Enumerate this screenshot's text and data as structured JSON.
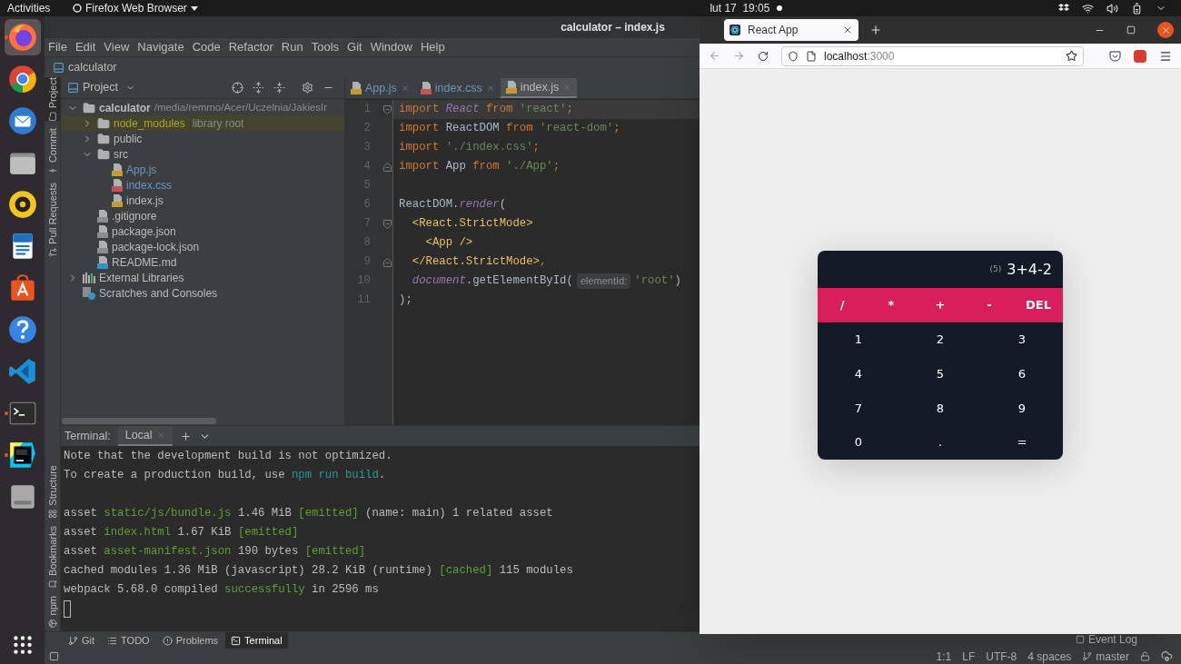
{
  "top_bar": {
    "activities": "Activities",
    "app_menu": "Firefox Web Browser",
    "clock": "lut 17  19:05"
  },
  "dock": [
    {
      "kind": "firefox",
      "running": true,
      "selected": true
    },
    {
      "kind": "chrome",
      "running": false,
      "selected": false
    },
    {
      "kind": "mail",
      "running": false,
      "selected": false
    },
    {
      "kind": "files",
      "running": false,
      "selected": false
    },
    {
      "kind": "music",
      "running": false,
      "selected": false
    },
    {
      "kind": "writer",
      "running": false,
      "selected": false
    },
    {
      "kind": "store",
      "running": false,
      "selected": false
    },
    {
      "kind": "help",
      "running": false,
      "selected": false
    },
    {
      "kind": "vscode",
      "running": false,
      "selected": false
    },
    {
      "kind": "terminal",
      "running": true,
      "selected": false
    },
    {
      "kind": "webstorm",
      "running": true,
      "selected": false
    },
    {
      "kind": "drive",
      "running": false,
      "selected": false
    }
  ],
  "ide": {
    "title": "calculator – index.js",
    "menu": [
      "File",
      "Edit",
      "View",
      "Navigate",
      "Code",
      "Refactor",
      "Run",
      "Tools",
      "Git",
      "Window",
      "Help"
    ],
    "breadcrumb": "calculator",
    "left_tabs": [
      {
        "label": "Project",
        "kind": "project",
        "selected": true
      },
      {
        "label": "Commit",
        "kind": "commit",
        "selected": false
      },
      {
        "label": "Pull Requests",
        "kind": "pull",
        "selected": false
      }
    ],
    "left_tabs_bottom": [
      {
        "label": "Structure",
        "kind": "structure",
        "selected": false
      },
      {
        "label": "Bookmarks",
        "kind": "bookmarks",
        "selected": false
      },
      {
        "label": "npm",
        "kind": "npm",
        "selected": false
      }
    ],
    "project": {
      "title": "Project",
      "tree": [
        {
          "kind": "root",
          "label": "calculator",
          "path": "/media/remmo/Acer/Uczelnia/JakiesIr",
          "expanded": true,
          "children": [
            {
              "kind": "excluded",
              "label": "node_modules",
              "note": "library root",
              "expanded": false
            },
            {
              "kind": "folder",
              "label": "public",
              "expanded": false
            },
            {
              "kind": "folder",
              "label": "src",
              "expanded": true,
              "children": [
                {
                  "kind": "js",
                  "label": "App.js",
                  "modified": true
                },
                {
                  "kind": "css",
                  "label": "index.css",
                  "modified": true
                },
                {
                  "kind": "js",
                  "label": "index.js",
                  "modified": false
                }
              ]
            },
            {
              "kind": "config",
              "label": ".gitignore",
              "modified": false
            },
            {
              "kind": "config",
              "label": "package.json",
              "modified": false
            },
            {
              "kind": "config",
              "label": "package-lock.json",
              "modified": false
            },
            {
              "kind": "md",
              "label": "README.md",
              "modified": false
            }
          ]
        },
        {
          "kind": "libraries",
          "label": "External Libraries",
          "expanded": false
        },
        {
          "kind": "scratches",
          "label": "Scratches and Consoles"
        }
      ]
    },
    "editor": {
      "tabs": [
        {
          "label": "App.js",
          "kind": "js",
          "modified": true,
          "selected": false
        },
        {
          "label": "index.css",
          "kind": "css",
          "modified": true,
          "selected": false
        },
        {
          "label": "index.js",
          "kind": "js",
          "modified": false,
          "selected": true
        }
      ],
      "lines": [
        {
          "number": "1",
          "current": true,
          "kind": "fold_start",
          "tokens": [
            {
              "text": "import ",
              "kind": "kw"
            },
            {
              "text": "React",
              "kind": "member"
            },
            {
              "text": " from ",
              "kind": "kw"
            },
            {
              "text": "'react'",
              "kind": "str"
            },
            {
              "text": ";",
              "kind": "kw"
            }
          ]
        },
        {
          "number": "2",
          "current": false,
          "kind": "plain",
          "tokens": [
            {
              "text": "import ",
              "kind": "kw"
            },
            {
              "text": "ReactDOM",
              "kind": "id"
            },
            {
              "text": " from ",
              "kind": "kw"
            },
            {
              "text": "'react-dom'",
              "kind": "str"
            },
            {
              "text": ";",
              "kind": "kw"
            }
          ]
        },
        {
          "number": "3",
          "current": false,
          "kind": "plain",
          "tokens": [
            {
              "text": "import ",
              "kind": "kw"
            },
            {
              "text": "'./index.css'",
              "kind": "str"
            },
            {
              "text": ";",
              "kind": "kw"
            }
          ]
        },
        {
          "number": "4",
          "current": false,
          "kind": "fold_end",
          "tokens": [
            {
              "text": "import ",
              "kind": "kw"
            },
            {
              "text": "App",
              "kind": "id"
            },
            {
              "text": " from ",
              "kind": "kw"
            },
            {
              "text": "'./App'",
              "kind": "str"
            },
            {
              "text": ";",
              "kind": "kw"
            }
          ]
        },
        {
          "number": "5",
          "current": false,
          "kind": "plain"
        },
        {
          "number": "6",
          "current": false,
          "kind": "plain",
          "tokens": [
            {
              "text": "ReactDOM.",
              "kind": "id"
            },
            {
              "text": "render",
              "kind": "member"
            },
            {
              "text": "(",
              "kind": "id"
            }
          ]
        },
        {
          "number": "7",
          "current": false,
          "kind": "fold_start",
          "tokens": [
            {
              "text": "  <React.StrictMode>",
              "kind": "tag"
            }
          ]
        },
        {
          "number": "8",
          "current": false,
          "kind": "plain",
          "tokens": [
            {
              "text": "    <App />",
              "kind": "tag"
            }
          ]
        },
        {
          "number": "9",
          "current": false,
          "kind": "fold_end",
          "tokens": [
            {
              "text": "  </React.StrictMode>",
              "kind": "tag"
            },
            {
              "text": ",",
              "kind": "kw"
            }
          ]
        },
        {
          "number": "10",
          "current": false,
          "kind": "plain",
          "tokens": [
            {
              "text": "  document",
              "kind": "member"
            },
            {
              "text": ".getElementById(",
              "kind": "id"
            },
            {
              "text": "elementId:",
              "kind": "hint"
            },
            {
              "text": "'root'",
              "kind": "str"
            },
            {
              "text": ")",
              "kind": "id"
            }
          ]
        },
        {
          "number": "11",
          "current": false,
          "kind": "plain",
          "tokens": [
            {
              "text": ");",
              "kind": "id"
            }
          ]
        }
      ]
    },
    "terminal": {
      "title": "Terminal:",
      "tabs": [
        {
          "label": "Local",
          "selected": true
        }
      ],
      "blocks": [
        [
          [
            {
              "text": "Note that the development build is not optimized.",
              "kind": "plain"
            }
          ],
          [
            {
              "text": "To create a production build, use ",
              "kind": "plain"
            },
            {
              "text": "npm run build",
              "kind": "command"
            },
            {
              "text": ".",
              "kind": "plain"
            }
          ]
        ],
        [
          [
            {
              "text": "asset ",
              "kind": "plain"
            },
            {
              "text": "static/js/bundle.js",
              "kind": "ok"
            },
            {
              "text": " 1.46 MiB ",
              "kind": "plain"
            },
            {
              "text": "[emitted]",
              "kind": "ok"
            },
            {
              "text": " (name: main) 1 related asset",
              "kind": "plain"
            }
          ],
          [
            {
              "text": "asset ",
              "kind": "plain"
            },
            {
              "text": "index.html",
              "kind": "ok"
            },
            {
              "text": " 1.67 KiB ",
              "kind": "plain"
            },
            {
              "text": "[emitted]",
              "kind": "ok"
            }
          ],
          [
            {
              "text": "asset ",
              "kind": "plain"
            },
            {
              "text": "asset-manifest.json",
              "kind": "ok"
            },
            {
              "text": " 190 bytes ",
              "kind": "plain"
            },
            {
              "text": "[emitted]",
              "kind": "ok"
            }
          ],
          [
            {
              "text": "cached modules 1.36 MiB (javascript) 28.2 KiB (runtime) ",
              "kind": "plain"
            },
            {
              "text": "[cached]",
              "kind": "ok"
            },
            {
              "text": " 115 modules",
              "kind": "plain"
            }
          ],
          [
            {
              "text": "webpack 5.68.0 compiled ",
              "kind": "plain"
            },
            {
              "text": "successfully",
              "kind": "ok"
            },
            {
              "text": " in 2596 ms",
              "kind": "plain"
            }
          ]
        ]
      ]
    },
    "tool_tabs": [
      {
        "label": "Git",
        "kind": "git",
        "selected": false
      },
      {
        "label": "TODO",
        "kind": "todo",
        "selected": false
      },
      {
        "label": "Problems",
        "kind": "problems",
        "selected": false
      },
      {
        "label": "Terminal",
        "kind": "terminal",
        "selected": true
      }
    ],
    "event_log": "Event Log",
    "status": [
      {
        "text": "1:1",
        "kind": "text"
      },
      {
        "text": "LF",
        "kind": "text"
      },
      {
        "text": "UTF-8",
        "kind": "text"
      },
      {
        "text": "4 spaces",
        "kind": "text"
      },
      {
        "text": "master",
        "kind": "branch"
      }
    ]
  },
  "browser": {
    "tabs": [
      {
        "title": "React App",
        "selected": true
      }
    ],
    "url": {
      "host": "localhost",
      "port": ":3000"
    },
    "calculator": {
      "previous": "(5)",
      "current": "3+4-2",
      "operators": [
        "/",
        "*",
        "+",
        "-",
        "DEL"
      ],
      "keys": [
        "1",
        "2",
        "3",
        "4",
        "5",
        "6",
        "7",
        "8",
        "9",
        "0",
        ".",
        "="
      ]
    }
  }
}
